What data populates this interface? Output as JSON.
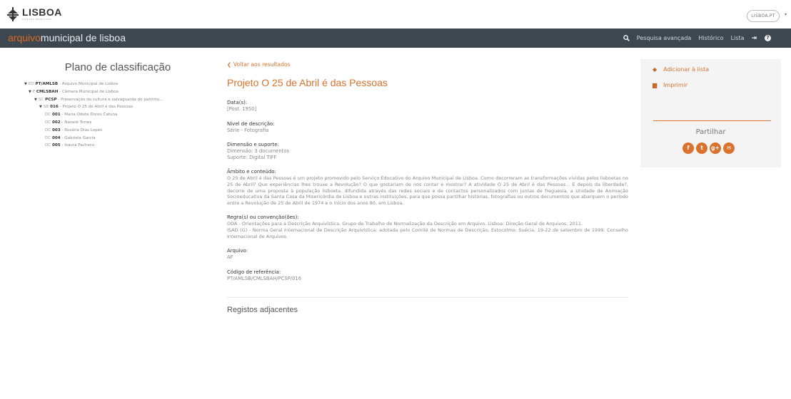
{
  "header": {
    "logo_text": "LISBOA",
    "logo_sub": "CÂMARA MUNICIPAL",
    "site_pill": "LISBOA.PT",
    "caret": "▾"
  },
  "nav": {
    "title_part1": "arquivo",
    "title_part2": "municipal de lisboa",
    "links": [
      {
        "label": "Pesquisa avançada"
      },
      {
        "label": "Histórico"
      },
      {
        "label": "Lista"
      }
    ],
    "icons": [
      "search-icon",
      "login-icon",
      "help-icon"
    ]
  },
  "tree": {
    "title": "Plano de classificação",
    "nodes": [
      {
        "caret": "▼",
        "level": "ED",
        "code": "PT/AMLSB",
        "label": " - Arquivo Municipal de Lisboa"
      },
      {
        "caret": "▼",
        "level": "F",
        "code": "CMLSBAH",
        "label": " - Câmara Municipal de Lisboa"
      },
      {
        "caret": "▼",
        "level": "SC",
        "code": "PCSP",
        "label": " - Preservação da cultura e salvaguarda do patrimo..."
      },
      {
        "caret": "▼",
        "level": "SR",
        "code": "016",
        "label": " - Projeto O 25 de Abril é das Pessoas"
      },
      {
        "caret": "",
        "level": "DC",
        "code": "001",
        "label": " - Maria Odete Dores Catuna"
      },
      {
        "caret": "",
        "level": "DC",
        "code": "002",
        "label": " - Nazaré Torres"
      },
      {
        "caret": "",
        "level": "DC",
        "code": "003",
        "label": " - Rosária Dias Lopes"
      },
      {
        "caret": "",
        "level": "DC",
        "code": "004",
        "label": " - Gabriela Garcia"
      },
      {
        "caret": "",
        "level": "DC",
        "code": "005",
        "label": " - Isaura Pacheco"
      }
    ]
  },
  "record": {
    "back_label": "Voltar aos resultados",
    "title": "Projeto O 25 de Abril é das Pessoas",
    "fields": {
      "datas": {
        "label": "Data(s):",
        "value": "[Post. 1950]"
      },
      "nivel": {
        "label": "Nível de descrição:",
        "value": "Série - Fotografia"
      },
      "dimensao": {
        "label": "Dimensão e suporte:",
        "value1": "Dimensão: 3 documentos",
        "value2": "Suporte: Digital TIFF"
      },
      "ambito": {
        "label": "Âmbito e conteúdo:",
        "value": "O 25 de Abril é das Pessoas é um projeto promovido pelo Serviço Educativo do Arquivo Municipal de Lisboa. Como decorreram as transformações vividas pelos lisboetas no 25 de Abril? Que experiências lhes trouxe a Revolução? O que gostariam de nos contar e mostrar? A atividade O 25 de Abril é das Pessoas... E depois da liberdade?, decorre de uma proposta à população lisboeta, difundida através das redes sociais e de contactos personalizados com juntas de freguesia, a Unidade de Animação Socioeducativa da Santa Casa da Misericórdia de Lisboa e outras instituições, para que possa partilhar histórias, fotografias ou outros documentos que abarquem o período entre a Revolução de 25 de Abril de 1974 e o início dos anos 80, em Lisboa."
      },
      "regras": {
        "label": "Regra(s) ou convenção(ões):",
        "value1": "ODA - Orientações para a Descrição Arquivística. Grupo de Trabalho de Normalização da Descrição em Arquivo. Lisboa: Direção Geral de Arquivos, 2011.",
        "value2": "ISAD (G) - Norma Geral Internacional de Descrição Arquivística: adotada pelo Comité de Normas de Descrição, Estocolmo: Suécia, 19-22 de setembro de 1999. Conselho Internacional de Arquivos."
      },
      "arquivo": {
        "label": "Arquivo:",
        "value": "AF"
      },
      "codigo": {
        "label": "Código de referência:",
        "value": "PT/AMLSB/CMLSBAH/PCSP/016"
      }
    },
    "adjacent_title": "Registos adjacentes"
  },
  "panel": {
    "add_label": "Adicionar à lista",
    "print_label": "Imprimir",
    "share_label": "Partilhar",
    "share_buttons": [
      {
        "icon": "facebook-icon",
        "glyph": "f"
      },
      {
        "icon": "twitter-icon",
        "glyph": "t"
      },
      {
        "icon": "googleplus-icon",
        "glyph": "g+"
      },
      {
        "icon": "email-icon",
        "glyph": "✉"
      }
    ]
  },
  "colors": {
    "accent": "#d8722d",
    "nav_bg": "#3d4750",
    "panel_bg": "#f4f4f4"
  }
}
